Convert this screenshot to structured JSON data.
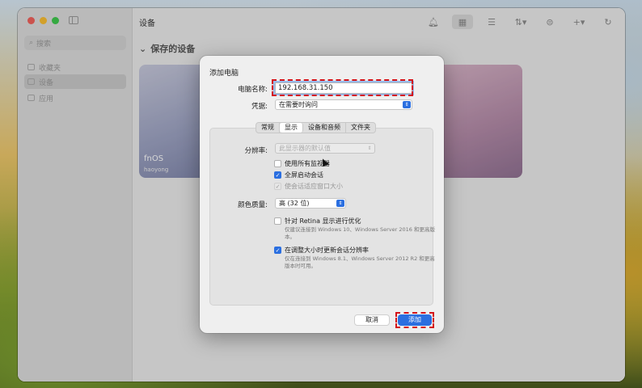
{
  "window": {
    "title": "设备"
  },
  "sidebar": {
    "search_placeholder": "搜索",
    "items": [
      {
        "label": "收藏夹"
      },
      {
        "label": "设备"
      },
      {
        "label": "应用"
      }
    ]
  },
  "main": {
    "section_title": "保存的设备",
    "cards": [
      {
        "name": "fnOS",
        "user": "haoyong"
      },
      {
        "name": "",
        "user": ""
      }
    ]
  },
  "dialog": {
    "title": "添加电脑",
    "pc_name_label": "电脑名称:",
    "pc_name_value": "192.168.31.150",
    "credentials_label": "凭据:",
    "credentials_value": "在需要时询问",
    "tabs": [
      {
        "label": "常规"
      },
      {
        "label": "显示"
      },
      {
        "label": "设备和音频"
      },
      {
        "label": "文件夹"
      }
    ],
    "resolution_label": "分辨率:",
    "resolution_value": "此显示器的默认值",
    "chk_use_all_monitors": "使用所有监视器",
    "chk_fullscreen": "全屏启动会话",
    "chk_fit_window": "使会话适应窗口大小",
    "color_quality_label": "颜色质量:",
    "color_quality_value": "高 (32 位)",
    "chk_retina": "针对 Retina 显示进行优化",
    "retina_note": "仅建议连接到 Windows 10、Windows Server 2016 和更高版本。",
    "chk_update_resolution": "在调整大小时更新会话分辨率",
    "update_note": "仅在连接到 Windows 8.1、Windows Server 2012 R2 和更高版本时可用。",
    "cancel_label": "取消",
    "add_label": "添加"
  }
}
